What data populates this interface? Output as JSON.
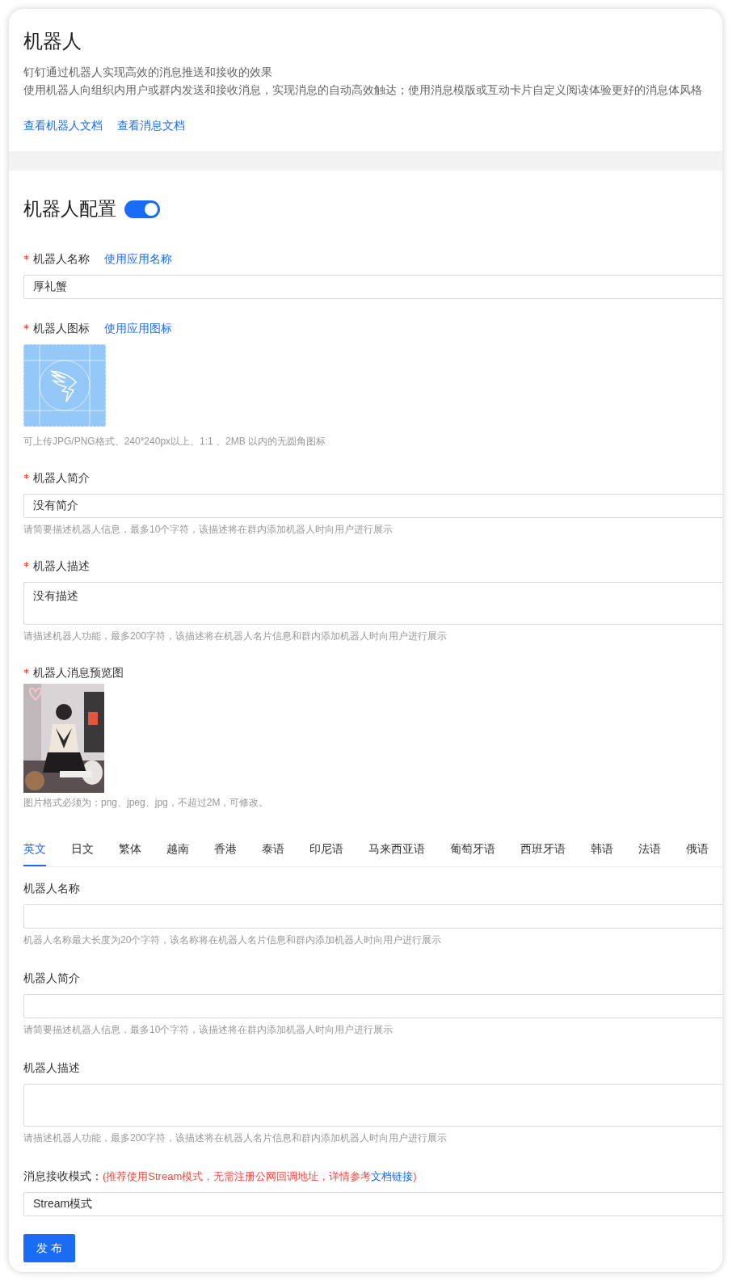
{
  "header": {
    "title": "机器人",
    "lines": [
      "钉钉通过机器人实现高效的消息推送和接收的效果",
      "使用机器人向组织内用户或群内发送和接收消息，实现消息的自动高效触达；使用消息模版或互动卡片自定义阅读体验更好的消息体风格"
    ],
    "links": [
      "查看机器人文档",
      "查看消息文档"
    ]
  },
  "config": {
    "title": "机器人配置",
    "toggle_on": true
  },
  "fields": [
    {
      "kind": "input",
      "label": "机器人名称",
      "required": true,
      "action": "使用应用名称",
      "value": "厚礼蟹"
    },
    {
      "kind": "icon",
      "label": "机器人图标",
      "required": true,
      "action": "使用应用图标",
      "hint": "可上传JPG/PNG格式、240*240px以上、1:1 、2MB 以内的无圆角图标"
    },
    {
      "kind": "input",
      "label": "机器人简介",
      "required": true,
      "value": "没有简介",
      "hint": "请简要描述机器人信息，最多10个字符，该描述将在群内添加机器人时向用户进行展示"
    },
    {
      "kind": "textarea",
      "label": "机器人描述",
      "required": true,
      "value": "没有描述",
      "hint": "请描述机器人功能，最多200字符，该描述将在机器人名片信息和群内添加机器人时向用户进行展示"
    },
    {
      "label": "机器人消息预览图",
      "required": true,
      "hint": "图片格式必须为：png、jpeg、jpg，不超过2M，可修改。"
    }
  ],
  "tabs": [
    {
      "label": "英文",
      "selected": true
    },
    {
      "label": "日文",
      "selected": false
    },
    {
      "label": "繁体",
      "selected": false
    },
    {
      "label": "越南",
      "selected": false
    },
    {
      "label": "香港",
      "selected": false
    },
    {
      "label": "泰语",
      "selected": false
    },
    {
      "label": "印尼语",
      "selected": false
    },
    {
      "label": "马来西亚语",
      "selected": false
    },
    {
      "label": "葡萄牙语",
      "selected": false
    },
    {
      "label": "西班牙语",
      "selected": false
    },
    {
      "label": "韩语",
      "selected": false
    },
    {
      "label": "法语",
      "selected": false
    },
    {
      "label": "俄语",
      "selected": false
    }
  ],
  "lang_fields": [
    {
      "kind": "input",
      "label": "机器人名称",
      "hint": "机器人名称最大长度为20个字符，该名称将在机器人名片信息和群内添加机器人时向用户进行展示"
    },
    {
      "kind": "input",
      "label": "机器人简介",
      "hint": "请简要描述机器人信息，最多10个字符，该描述将在群内添加机器人时向用户进行展示"
    },
    {
      "kind": "textarea",
      "label": "机器人描述",
      "hint": "请描述机器人功能，最多200字符，该描述将在机器人名片信息和群内添加机器人时向用户进行展示"
    }
  ],
  "receive_mode": {
    "label": "消息接收模式：",
    "note_before": "(推荐使用Stream模式，无需注册公网回调地址，详情参考",
    "note_link": "文档链接",
    "note_after": ")",
    "value": "Stream模式"
  },
  "submit": "发 布"
}
